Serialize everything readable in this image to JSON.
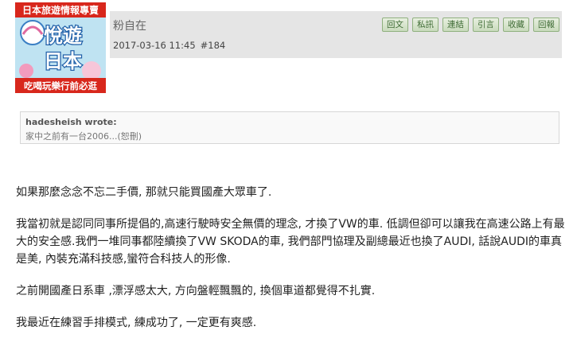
{
  "avatar": {
    "banner_text": "日本旅遊情報專賣",
    "title_text_1": "悅遊",
    "title_text_2": "日本",
    "footer_text": "吃喝玩樂行前必逛"
  },
  "post": {
    "username": "粉自在",
    "date": "2017-03-16 11:45",
    "post_number": "#184"
  },
  "actions": [
    {
      "label": "回文"
    },
    {
      "label": "私訊"
    },
    {
      "label": "連結"
    },
    {
      "label": "引言"
    },
    {
      "label": "收藏"
    },
    {
      "label": "回報"
    }
  ],
  "quote": {
    "author": "hadesheish wrote:",
    "excerpt": "家中之前有一台2006...(恕刪)"
  },
  "body": {
    "paragraphs": [
      "如果那麼念念不忘二手價, 那就只能買國產大眾車了.",
      "我當初就是認同同事所提倡的,高速行駛時安全無價的理念, 才換了VW的車. 低調但卻可以讓我在高速公路上有最大的安全感.我們一堆同事都陸續換了VW SKODA的車, 我們部門協理及副總最近也換了AUDI, 話說AUDI的車真是美, 內裝充滿科技感,蠻符合科技人的形像.",
      "之前開國產日系車 ,漂浮感太大, 方向盤輕飄飄的, 換個車道都覺得不扎實.",
      "我最近在練習手排模式, 練成功了, 一定更有爽感."
    ]
  },
  "colors": {
    "header_bg": "#e5e5e5",
    "button_text": "#3e6b34",
    "button_border": "#8fb07e",
    "avatar_banner": "#d8271c"
  }
}
